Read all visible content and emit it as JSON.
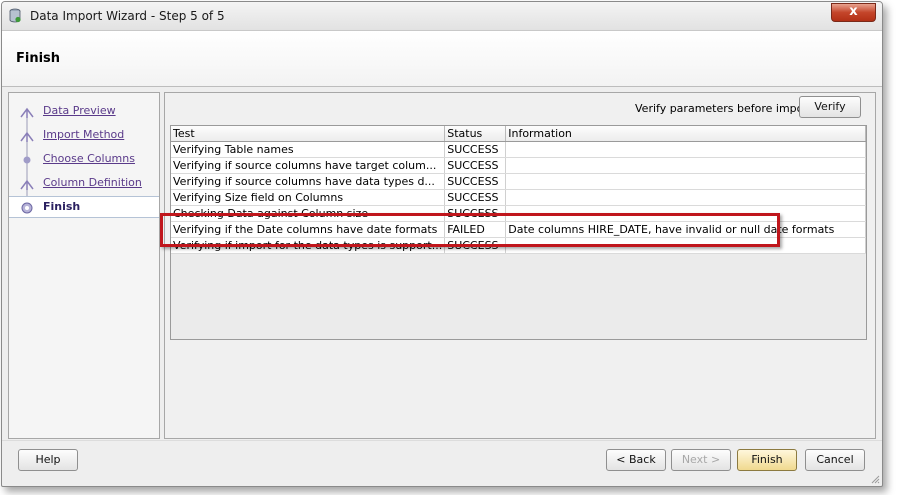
{
  "window": {
    "title": "Data Import Wizard - Step 5 of 5",
    "close_label": "x"
  },
  "header": {
    "page_title": "Finish"
  },
  "nav": {
    "items": [
      {
        "label": "Data Preview"
      },
      {
        "label": "Import Method"
      },
      {
        "label": "Choose Columns"
      },
      {
        "label": "Column Definition"
      },
      {
        "label": "Finish"
      }
    ]
  },
  "verify": {
    "label": "Verify parameters before import",
    "button": "Verify"
  },
  "grid": {
    "columns": [
      "Test",
      "Status",
      "Information"
    ],
    "rows": [
      {
        "test": "Verifying Table names",
        "status": "SUCCESS",
        "info": ""
      },
      {
        "test": "Verifying if source columns have target colum...",
        "status": "SUCCESS",
        "info": ""
      },
      {
        "test": "Verifying if source columns have data types d...",
        "status": "SUCCESS",
        "info": ""
      },
      {
        "test": "Verifying Size field on Columns",
        "status": "SUCCESS",
        "info": ""
      },
      {
        "test": "Checking Data against Column size",
        "status": "SUCCESS",
        "info": ""
      },
      {
        "test": "Verifying if the Date columns have date formats",
        "status": "FAILED",
        "info": "Date columns HIRE_DATE,  have invalid or null date formats"
      },
      {
        "test": "Verifying if import for the data types is support...",
        "status": "SUCCESS",
        "info": ""
      }
    ]
  },
  "footer": {
    "help": "Help",
    "back": "< Back",
    "next": "Next >",
    "finish": "Finish",
    "cancel": "Cancel"
  },
  "colors": {
    "highlight": "#c0161c",
    "nav_link": "#5a3a8a"
  }
}
